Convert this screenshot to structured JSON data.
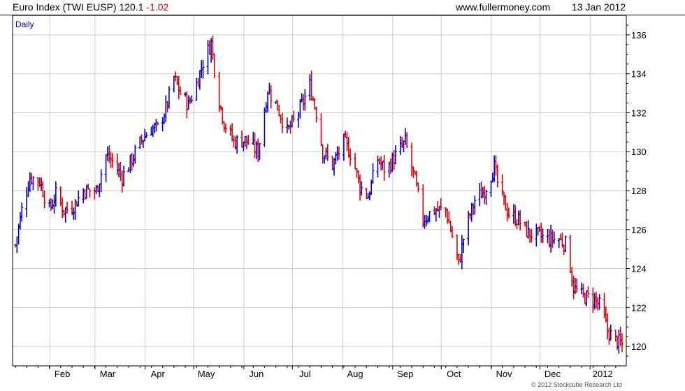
{
  "header": {
    "name": "Euro Index (TWI EUSP)",
    "price": "120.1",
    "change": "-1.02",
    "site": "www.fullermoney.com",
    "date": "13 Jan 2012"
  },
  "period_label": "Daily",
  "copyright": "© 2012 Stockcube Research Ltd",
  "colors": {
    "up": "#0000cc",
    "down": "#dd0000",
    "grid": "#cccccc",
    "axis": "#000000"
  },
  "chart_data": {
    "type": "bar",
    "title": "Euro Index (TWI EUSP)",
    "ylim": [
      119,
      137
    ],
    "yticks": [
      "120",
      "122",
      "124",
      "126",
      "128",
      "130",
      "132",
      "134",
      "136"
    ],
    "xticks": [
      "Feb",
      "Mar",
      "Apr",
      "May",
      "Jun",
      "Jul",
      "Aug",
      "Sep",
      "Oct",
      "Nov",
      "Dec",
      "2012"
    ],
    "grid": true,
    "axis_side": "right",
    "close_path": [
      [
        "2011-01-03",
        125.2
      ],
      [
        "2011-01-07",
        127.0
      ],
      [
        "2011-01-12",
        128.7
      ],
      [
        "2011-01-18",
        128.5
      ],
      [
        "2011-01-24",
        127.0
      ],
      [
        "2011-01-28",
        127.8
      ],
      [
        "2011-02-02",
        127.0
      ],
      [
        "2011-02-08",
        127.2
      ],
      [
        "2011-02-14",
        128.0
      ],
      [
        "2011-02-22",
        128.0
      ],
      [
        "2011-02-28",
        129.8
      ],
      [
        "2011-03-04",
        129.5
      ],
      [
        "2011-03-10",
        128.7
      ],
      [
        "2011-03-16",
        129.6
      ],
      [
        "2011-03-22",
        130.6
      ],
      [
        "2011-03-28",
        131.2
      ],
      [
        "2011-04-01",
        131.2
      ],
      [
        "2011-04-06",
        132.2
      ],
      [
        "2011-04-11",
        133.8
      ],
      [
        "2011-04-15",
        133.0
      ],
      [
        "2011-04-20",
        132.4
      ],
      [
        "2011-04-25",
        133.5
      ],
      [
        "2011-04-29",
        134.6
      ],
      [
        "2011-05-04",
        135.6
      ],
      [
        "2011-05-08",
        133.0
      ],
      [
        "2011-05-12",
        131.5
      ],
      [
        "2011-05-18",
        130.5
      ],
      [
        "2011-05-25",
        130.6
      ],
      [
        "2011-06-02",
        130.0
      ],
      [
        "2011-06-08",
        133.2
      ],
      [
        "2011-06-14",
        132.3
      ],
      [
        "2011-06-20",
        131.0
      ],
      [
        "2011-06-26",
        131.8
      ],
      [
        "2011-07-04",
        133.4
      ],
      [
        "2011-07-08",
        132.0
      ],
      [
        "2011-07-12",
        130.0
      ],
      [
        "2011-07-18",
        129.3
      ],
      [
        "2011-07-25",
        130.5
      ],
      [
        "2011-07-30",
        129.8
      ],
      [
        "2011-08-04",
        128.2
      ],
      [
        "2011-08-09",
        127.7
      ],
      [
        "2011-08-15",
        129.6
      ],
      [
        "2011-08-20",
        129.0
      ],
      [
        "2011-08-26",
        129.8
      ],
      [
        "2011-09-01",
        130.5
      ],
      [
        "2011-09-07",
        128.5
      ],
      [
        "2011-09-12",
        126.5
      ],
      [
        "2011-09-18",
        127.0
      ],
      [
        "2011-09-26",
        127.0
      ],
      [
        "2011-10-02",
        125.0
      ],
      [
        "2011-10-04",
        124.2
      ],
      [
        "2011-10-08",
        126.0
      ],
      [
        "2011-10-14",
        127.5
      ],
      [
        "2011-10-20",
        128.0
      ],
      [
        "2011-10-26",
        129.2
      ],
      [
        "2011-10-29",
        128.0
      ],
      [
        "2011-11-04",
        126.8
      ],
      [
        "2011-11-10",
        126.5
      ],
      [
        "2011-11-16",
        125.8
      ],
      [
        "2011-11-22",
        125.7
      ],
      [
        "2011-11-28",
        125.5
      ],
      [
        "2011-12-05",
        125.5
      ],
      [
        "2011-12-10",
        125.2
      ],
      [
        "2011-12-14",
        123.0
      ],
      [
        "2011-12-19",
        122.6
      ],
      [
        "2011-12-27",
        122.4
      ],
      [
        "2011-12-31",
        122.0
      ],
      [
        "2012-01-04",
        120.8
      ],
      [
        "2012-01-09",
        120.3
      ],
      [
        "2012-01-13",
        120.1
      ]
    ]
  }
}
